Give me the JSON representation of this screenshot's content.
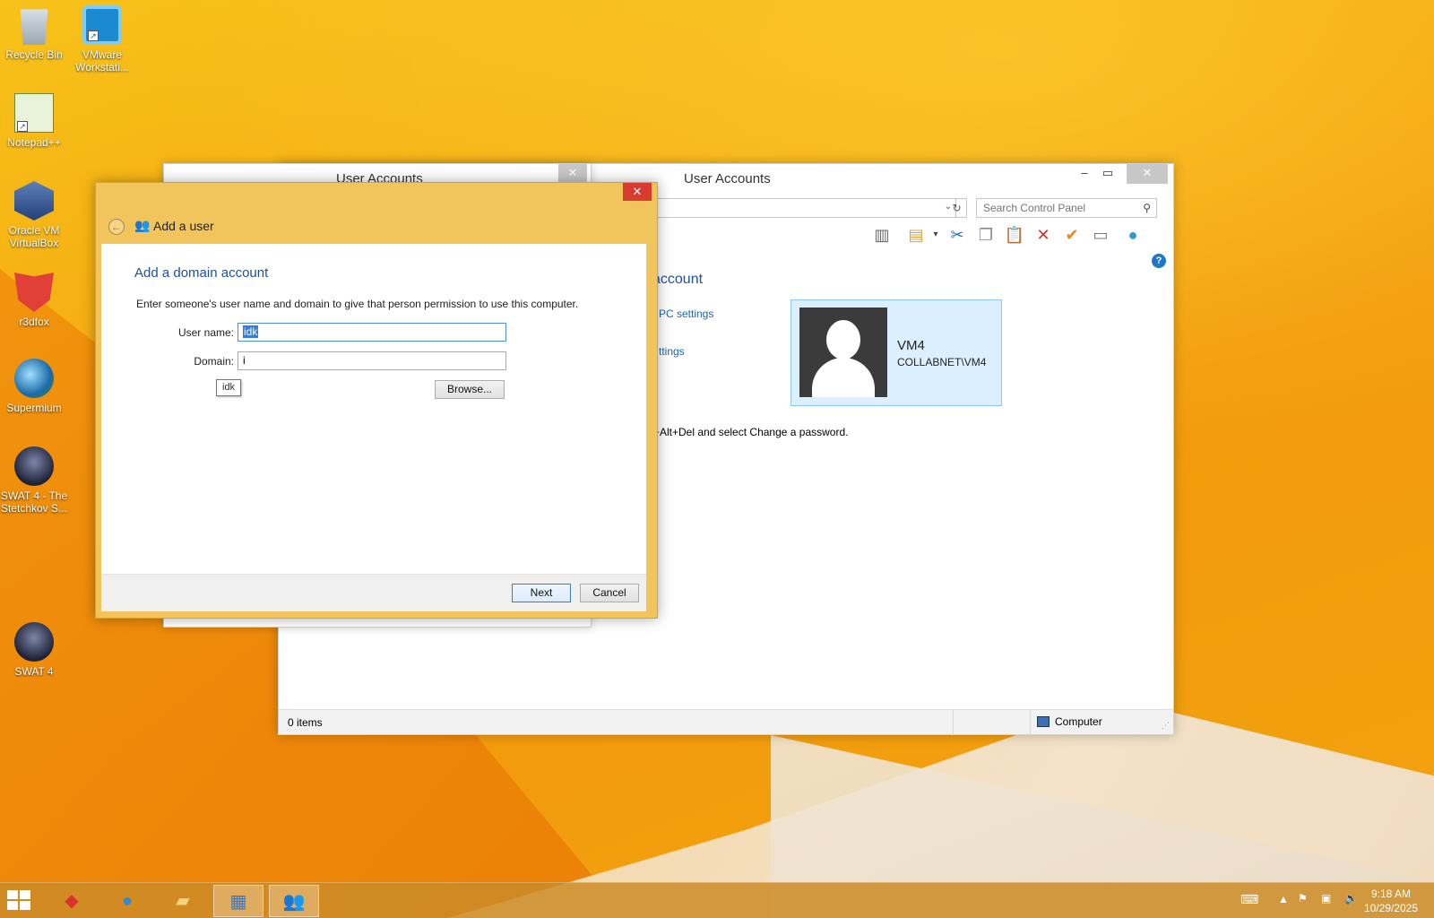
{
  "desktop": {
    "icons": [
      {
        "label": "Recycle Bin",
        "icon": "recycle-bin-icon"
      },
      {
        "label": "VMware Workstati...",
        "icon": "vmware-icon"
      },
      {
        "label": "Notepad++",
        "icon": "notepad-plus-plus-icon"
      },
      {
        "label": "Oracle VM VirtualBox",
        "icon": "virtualbox-icon"
      },
      {
        "label": "r3dfox",
        "icon": "r3dfox-icon"
      },
      {
        "label": "Supermium",
        "icon": "supermium-icon"
      },
      {
        "label": "SWAT 4 - The Stetchkov S...",
        "icon": "swat4-expansion-icon"
      },
      {
        "label": "SWAT 4",
        "icon": "swat4-icon"
      }
    ]
  },
  "control_panel": {
    "title": "User Accounts",
    "search_placeholder": "Search Control Panel",
    "address_fragment": "s",
    "heading_fragment": "account",
    "link_pc_settings": "PC settings",
    "link_settings_fragment": "ttings",
    "cad_text": "+Alt+Del and select Change a password.",
    "user": {
      "name": "VM4",
      "domain": "COLLABNET\\VM4"
    },
    "status_items": "0 items",
    "status_location": "Computer"
  },
  "middle_window": {
    "title": "User Accounts"
  },
  "dialog": {
    "header": "Add a user",
    "heading": "Add a domain account",
    "description": "Enter someone's user name and domain to give that person permission to use this computer.",
    "username_label": "User name:",
    "username_value": "idk",
    "domain_label": "Domain:",
    "domain_value": "i",
    "autocomplete_suggestion": "idk",
    "browse_label": "Browse...",
    "next_label": "Next",
    "cancel_label": "Cancel",
    "close_glyph": "✕"
  },
  "taskbar": {
    "time": "9:18 AM",
    "date": "10/29/2025",
    "apps": [
      "r3dfox-icon",
      "supermium-icon",
      "file-explorer-icon",
      "control-panel-icon",
      "user-accounts-icon"
    ]
  }
}
